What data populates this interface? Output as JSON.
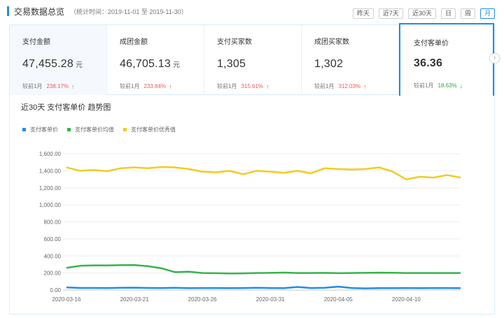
{
  "header": {
    "title": "交易数据总览",
    "range": "（统计时间：2019-11-01 至 2019-11-30）"
  },
  "periods": [
    {
      "label": "昨天",
      "active": false
    },
    {
      "label": "近7天",
      "active": false
    },
    {
      "label": "近30天",
      "active": false
    },
    {
      "label": "日",
      "active": false
    },
    {
      "label": "周",
      "active": false
    },
    {
      "label": "月",
      "active": true
    }
  ],
  "cards": [
    {
      "label": "支付金额",
      "value": "47,455.28",
      "unit": "元",
      "compare_label": "较前1月",
      "pct": "238.17%",
      "trend": "up"
    },
    {
      "label": "成团金额",
      "value": "46,705.13",
      "unit": "元",
      "compare_label": "较前1月",
      "pct": "233.84%",
      "trend": "up"
    },
    {
      "label": "支付买家数",
      "value": "1,305",
      "unit": "",
      "compare_label": "较前1月",
      "pct": "315.61%",
      "trend": "up"
    },
    {
      "label": "成团买家数",
      "value": "1,302",
      "unit": "",
      "compare_label": "较前1月",
      "pct": "312.03%",
      "trend": "up"
    },
    {
      "label": "支付客单价",
      "value": "36.36",
      "unit": "",
      "compare_label": "较前1月",
      "pct": "18.63%",
      "trend": "down"
    }
  ],
  "active_card_index": 4,
  "next_icon": "chevron-right-icon",
  "chart_title": "近30天 支付客单价 趋势图",
  "colors": {
    "accent": "#1f8ceb",
    "up": "#f05a5a",
    "down": "#2aa845"
  },
  "chart_data": {
    "type": "line",
    "x": [
      "2020-03-16",
      "2020-03-17",
      "2020-03-18",
      "2020-03-19",
      "2020-03-20",
      "2020-03-21",
      "2020-03-22",
      "2020-03-23",
      "2020-03-24",
      "2020-03-25",
      "2020-03-26",
      "2020-03-27",
      "2020-03-28",
      "2020-03-29",
      "2020-03-30",
      "2020-03-31",
      "2020-04-01",
      "2020-04-02",
      "2020-04-03",
      "2020-04-04",
      "2020-04-05",
      "2020-04-06",
      "2020-04-07",
      "2020-04-08",
      "2020-04-09",
      "2020-04-10",
      "2020-04-11",
      "2020-04-12",
      "2020-04-13",
      "2020-04-14"
    ],
    "x_tick_labels": [
      "2020-03-16",
      "2020-03-21",
      "2020-03-26",
      "2020-03-31",
      "2020-04-05",
      "2020-04-10"
    ],
    "ylim": [
      0,
      1600
    ],
    "yticks": [
      "0.00",
      "200.00",
      "400.00",
      "600.00",
      "800.00",
      "1,000.00",
      "1,200.00",
      "1,400.00",
      "1,600.00"
    ],
    "ytick_values": [
      0,
      200,
      400,
      600,
      800,
      1000,
      1200,
      1400,
      1600
    ],
    "grid": true,
    "legend_position": "top-left",
    "series": [
      {
        "name": "支付客单价",
        "color": "#1f8ceb",
        "values": [
          30,
          25,
          25,
          24,
          26,
          28,
          25,
          24,
          26,
          22,
          24,
          24,
          22,
          24,
          26,
          24,
          22,
          36,
          24,
          26,
          40,
          24,
          20,
          22,
          22,
          24,
          22,
          24,
          24,
          22
        ]
      },
      {
        "name": "支付客单价均值",
        "color": "#36b34a",
        "values": [
          260,
          285,
          290,
          290,
          292,
          294,
          280,
          255,
          210,
          215,
          200,
          198,
          195,
          196,
          200,
          202,
          205,
          200,
          200,
          202,
          198,
          200,
          202,
          204,
          203,
          200,
          200,
          200,
          200,
          200
        ]
      },
      {
        "name": "支付客单价优秀值",
        "color": "#f2cc1f",
        "values": [
          1440,
          1400,
          1410,
          1395,
          1430,
          1440,
          1430,
          1445,
          1440,
          1420,
          1390,
          1380,
          1400,
          1360,
          1400,
          1390,
          1375,
          1400,
          1370,
          1430,
          1420,
          1415,
          1420,
          1440,
          1390,
          1300,
          1330,
          1320,
          1350,
          1320
        ]
      }
    ]
  }
}
